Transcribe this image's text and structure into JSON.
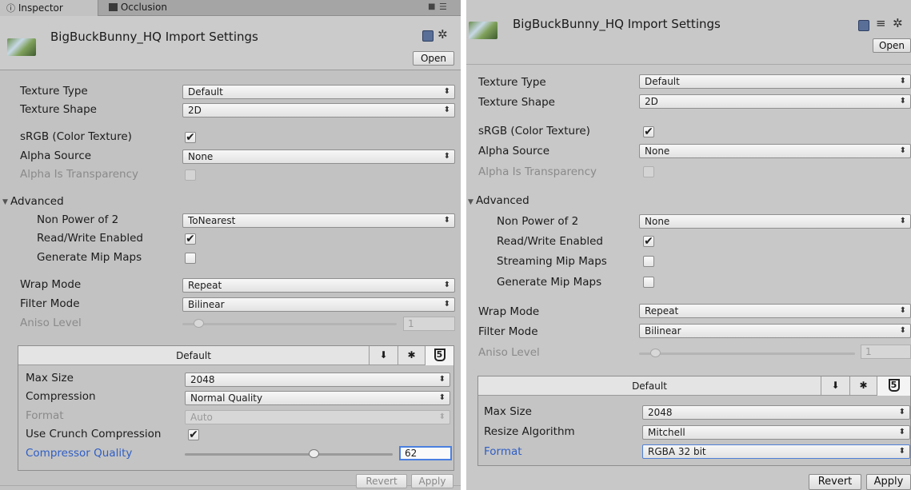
{
  "left": {
    "tabs": [
      {
        "label": "Inspector",
        "icon": "info-icon"
      },
      {
        "label": "Occlusion",
        "icon": "occlusion-icon"
      }
    ],
    "title": "BigBuckBunny_HQ Import Settings",
    "open_label": "Open",
    "rows": {
      "texture_type": {
        "label": "Texture Type",
        "value": "Default"
      },
      "texture_shape": {
        "label": "Texture Shape",
        "value": "2D"
      },
      "srgb": {
        "label": "sRGB (Color Texture)",
        "checked": true
      },
      "alpha_source": {
        "label": "Alpha Source",
        "value": "None"
      },
      "alpha_transparency": {
        "label": "Alpha Is Transparency",
        "checked": false
      },
      "advanced": {
        "label": "Advanced"
      },
      "npot": {
        "label": "Non Power of 2",
        "value": "ToNearest"
      },
      "read_write": {
        "label": "Read/Write Enabled",
        "checked": true
      },
      "gen_mip": {
        "label": "Generate Mip Maps",
        "checked": false
      },
      "wrap_mode": {
        "label": "Wrap Mode",
        "value": "Repeat"
      },
      "filter_mode": {
        "label": "Filter Mode",
        "value": "Bilinear"
      },
      "aniso": {
        "label": "Aniso Level",
        "value": "1"
      }
    },
    "platform": {
      "default_label": "Default",
      "max_size": {
        "label": "Max Size",
        "value": "2048"
      },
      "compression": {
        "label": "Compression",
        "value": "Normal Quality"
      },
      "format": {
        "label": "Format",
        "value": "Auto"
      },
      "crunch": {
        "label": "Use Crunch Compression",
        "checked": true
      },
      "quality": {
        "label": "Compressor Quality",
        "value": "62",
        "level": 0.62
      }
    },
    "revert_label": "Revert",
    "apply_label": "Apply"
  },
  "right": {
    "title": "BigBuckBunny_HQ Import Settings",
    "open_label": "Open",
    "rows": {
      "texture_type": {
        "label": "Texture Type",
        "value": "Default"
      },
      "texture_shape": {
        "label": "Texture Shape",
        "value": "2D"
      },
      "srgb": {
        "label": "sRGB (Color Texture)",
        "checked": true
      },
      "alpha_source": {
        "label": "Alpha Source",
        "value": "None"
      },
      "alpha_transparency": {
        "label": "Alpha Is Transparency",
        "checked": false
      },
      "advanced": {
        "label": "Advanced"
      },
      "npot": {
        "label": "Non Power of 2",
        "value": "None"
      },
      "read_write": {
        "label": "Read/Write Enabled",
        "checked": true
      },
      "stream_mip": {
        "label": "Streaming Mip Maps",
        "checked": false
      },
      "gen_mip": {
        "label": "Generate Mip Maps",
        "checked": false
      },
      "wrap_mode": {
        "label": "Wrap Mode",
        "value": "Repeat"
      },
      "filter_mode": {
        "label": "Filter Mode",
        "value": "Bilinear"
      },
      "aniso": {
        "label": "Aniso Level",
        "value": "1"
      }
    },
    "platform": {
      "default_label": "Default",
      "max_size": {
        "label": "Max Size",
        "value": "2048"
      },
      "resize": {
        "label": "Resize Algorithm",
        "value": "Mitchell"
      },
      "format": {
        "label": "Format",
        "value": "RGBA 32 bit"
      }
    },
    "revert_label": "Revert",
    "apply_label": "Apply"
  },
  "glyphs": {
    "dropdown_arrow": "⬍",
    "check": "✔",
    "foldout": "▼",
    "info": "🛈",
    "download": "⬇",
    "android": "✱",
    "html5": "5",
    "gear": "✲",
    "lock": "🔒",
    "menu": "☰"
  },
  "colors": {
    "panel_bg": "#c2c2c2",
    "label_blue": "#2f5ec4",
    "focus_blue": "#4a7fe0"
  }
}
